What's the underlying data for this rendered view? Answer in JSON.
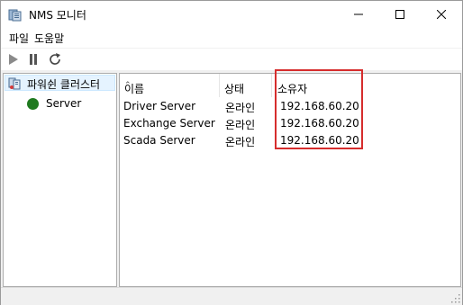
{
  "window": {
    "title": "NMS 모니터"
  },
  "menu": {
    "file": "파일",
    "help": "도움말"
  },
  "toolbar": {
    "icons": [
      "play-icon",
      "pause-icon",
      "refresh-icon"
    ]
  },
  "tree": {
    "root_label": "파워쉰 클러스터",
    "child_label": "Server",
    "child_status_color": "#1f7a1f"
  },
  "table": {
    "headers": {
      "name": "이름",
      "status": "상태",
      "owner": "소유자"
    },
    "rows": [
      {
        "name": "Driver Server",
        "status": "온라인",
        "owner": "192.168.60.20"
      },
      {
        "name": "Exchange Server",
        "status": "온라인",
        "owner": "192.168.60.20"
      },
      {
        "name": "Scada Server",
        "status": "온라인",
        "owner": "192.168.60.20"
      }
    ]
  },
  "colors": {
    "highlight": "#d62d2d",
    "selection": "#e5f3ff"
  }
}
